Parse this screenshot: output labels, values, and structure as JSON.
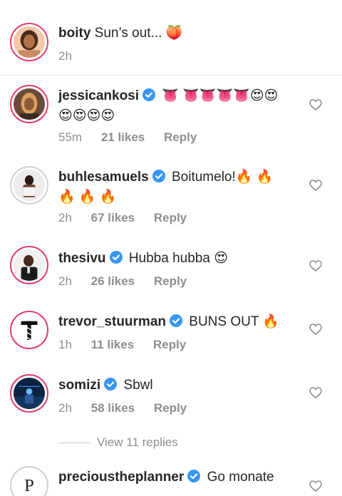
{
  "caption": {
    "username": "boity",
    "text": "Sun’s out... 🍑",
    "time": "2h"
  },
  "comments": [
    {
      "username": "jessicankosi",
      "text_line1": "👅 👅👅👅👅😍😍",
      "text_line2": "😍😍😍😍",
      "time": "55m",
      "likes": "21 likes",
      "reply": "Reply"
    },
    {
      "username": "buhlesamuels",
      "text_line1": "Boitumelo!🔥 🔥",
      "text_line2": "🔥 🔥 🔥",
      "time": "2h",
      "likes": "67 likes",
      "reply": "Reply"
    },
    {
      "username": "thesivu",
      "text_line1": "Hubba hubba 😍",
      "time": "2h",
      "likes": "26 likes",
      "reply": "Reply"
    },
    {
      "username": "trevor_stuurman",
      "text_line1": "BUNS OUT 🔥",
      "time": "1h",
      "likes": "11 likes",
      "reply": "Reply"
    },
    {
      "username": "somizi",
      "text_line1": "Sbwl",
      "time": "2h",
      "likes": "58 likes",
      "reply": "Reply"
    },
    {
      "username": "precioustheplanner",
      "text_line1": "Go monate"
    }
  ],
  "view_replies": "View 11 replies",
  "icons": {
    "heart": "heart-outline-icon",
    "verified": "verified-badge-icon"
  },
  "colors": {
    "verified": "#3897f0",
    "story_ring": "#e23b6c",
    "meta_text": "#8e8e8e",
    "divider": "#e4e4e4"
  }
}
